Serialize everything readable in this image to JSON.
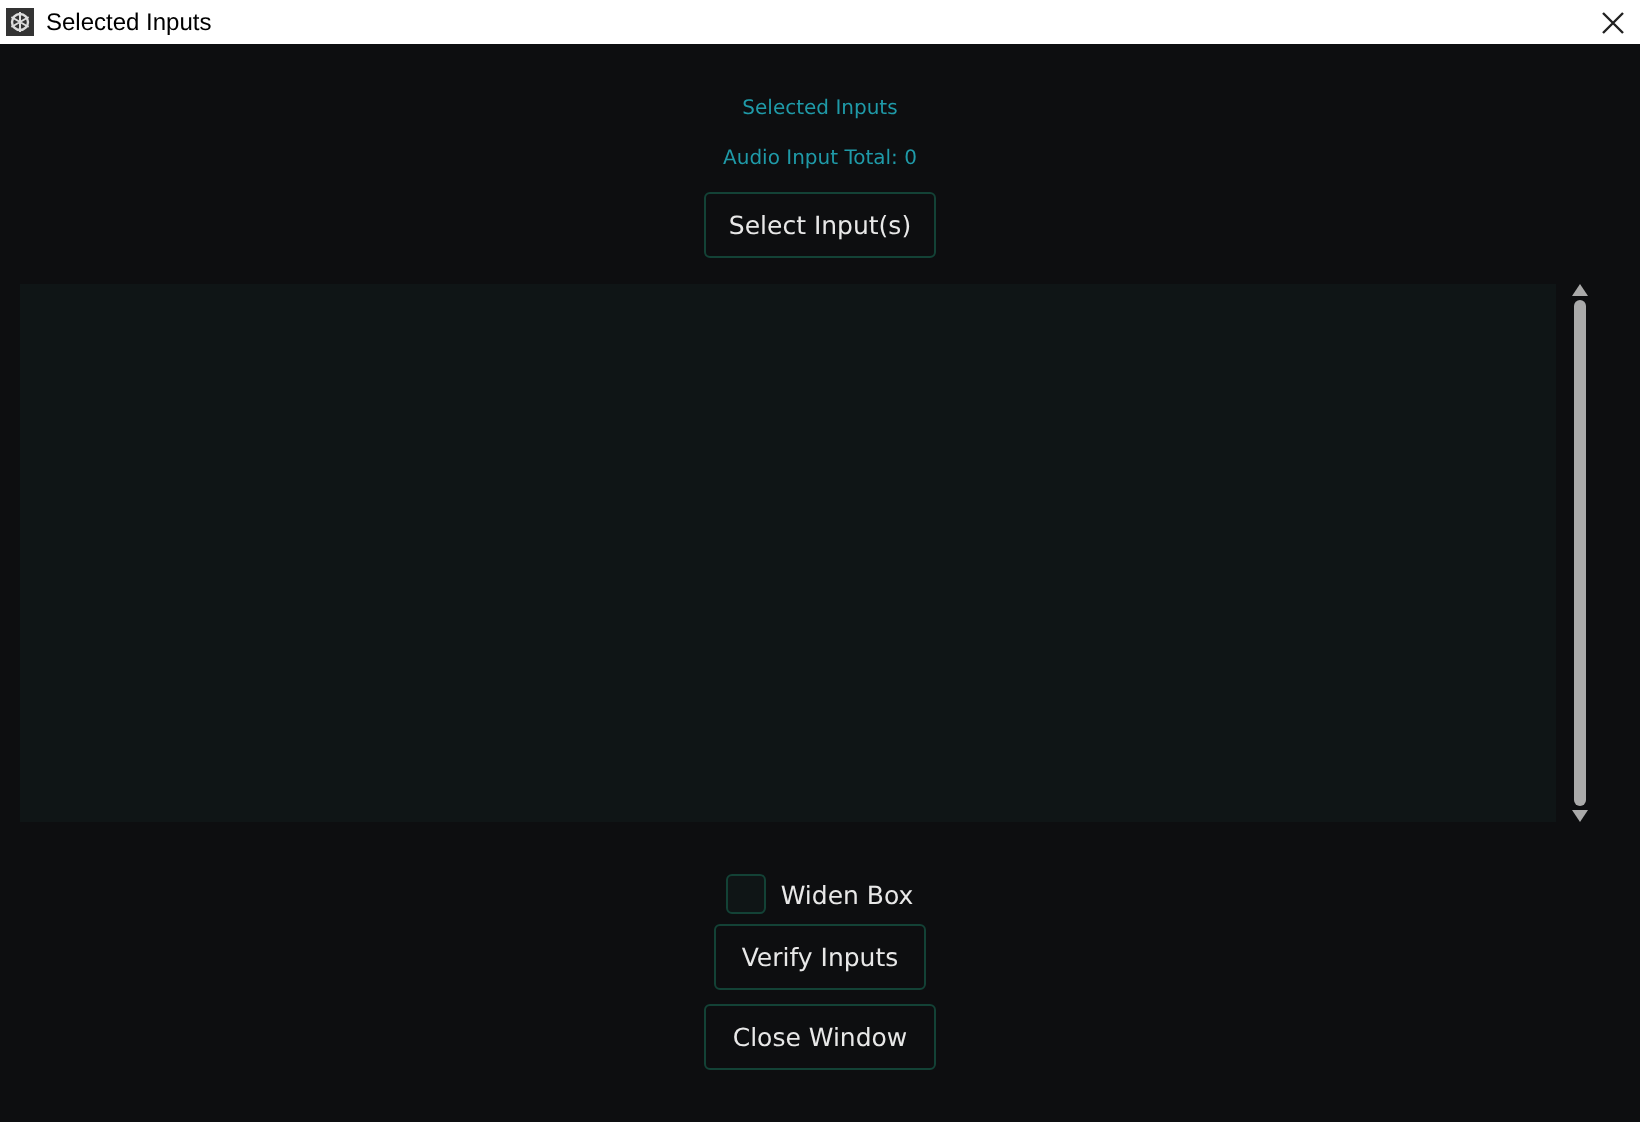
{
  "window": {
    "title": "Selected Inputs"
  },
  "heading": "Selected Inputs",
  "total": "Audio Input Total: 0",
  "select_button": "Select Input(s)",
  "widen_box": {
    "label": "Widen Box",
    "checked": false
  },
  "buttons": [
    "Verify Inputs",
    "Close Window"
  ]
}
